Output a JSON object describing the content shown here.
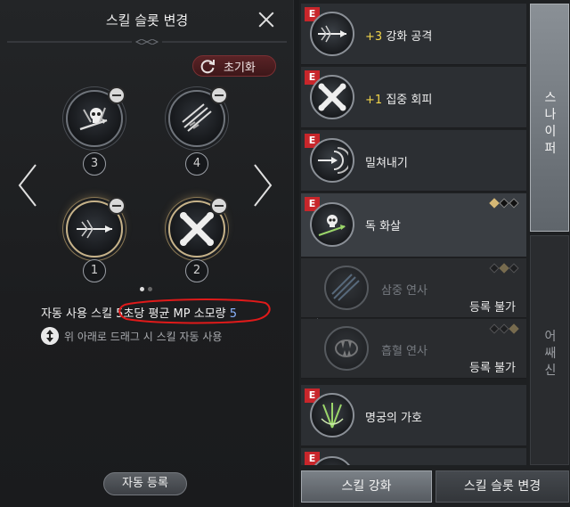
{
  "left_panel": {
    "title": "스킬 슬롯 변경",
    "reset_label": "초기화",
    "slots": [
      {
        "number": "3",
        "icon": "poison-arrow-skull-icon"
      },
      {
        "number": "4",
        "icon": "multi-arrow-icon"
      },
      {
        "number": "1",
        "icon": "piercing-arrow-icon"
      },
      {
        "number": "2",
        "icon": "crossed-bones-icon"
      }
    ],
    "auto_use_prefix": "자동 사용 스킬",
    "auto_use_highlight": "5초당 평균 MP 소모량",
    "auto_use_value": "5",
    "drag_hint": "위 아래로 드래그 시 스킬 자동 사용",
    "auto_register_label": "자동 등록"
  },
  "skill_list": [
    {
      "badge": "E",
      "plus": "+3",
      "name": "강화 공격",
      "icon": "piercing-arrow-icon"
    },
    {
      "badge": "E",
      "plus": "+1",
      "name": "집중 회피",
      "icon": "crossed-bones-icon"
    },
    {
      "badge": "E",
      "plus": "",
      "name": "밀쳐내기",
      "icon": "target-arrow-icon"
    },
    {
      "badge": "E",
      "plus": "",
      "name": "독 화살",
      "icon": "poison-arrow-skull-icon",
      "diamonds": [
        true,
        false,
        false
      ]
    },
    {
      "badge": "",
      "plus": "",
      "name": "삼중 연사",
      "icon": "triple-arrow-icon",
      "status": "등록 불가",
      "diamonds": [
        false,
        true,
        false
      ]
    },
    {
      "badge": "",
      "plus": "",
      "name": "흡혈 연사",
      "icon": "fang-icon",
      "status": "등록 불가",
      "diamonds": [
        false,
        false,
        true
      ]
    },
    {
      "badge": "E",
      "plus": "",
      "name": "명궁의 가호",
      "icon": "arrow-fan-icon"
    },
    {
      "badge": "E",
      "plus": "",
      "name": "",
      "icon": ""
    }
  ],
  "tabs": {
    "sniper": "스나이퍼",
    "assassin": "어쌔신"
  },
  "bottom_buttons": {
    "enhance": "스킬 강화",
    "slot_change": "스킬 슬롯 변경"
  },
  "colors": {
    "accent_gold": "#d6b875",
    "plus_yellow": "#f2d54a",
    "mp_value_blue": "#8ab4ff",
    "badge_red": "#c8262b",
    "annotation_red": "#e01a1a"
  }
}
